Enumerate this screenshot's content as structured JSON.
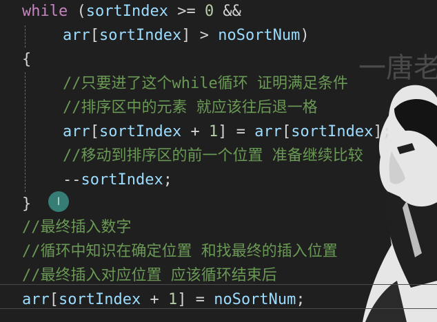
{
  "code": {
    "line1": {
      "kw": "while",
      "paren": " (",
      "var": "sortIndex",
      "op": " >= ",
      "num": "0",
      "and": " &&"
    },
    "line2": {
      "var1": "arr",
      "br1": "[",
      "var2": "sortIndex",
      "br2": "]",
      "op": " > ",
      "var3": "noSortNum",
      "close": ")"
    },
    "line3": {
      "text": "{"
    },
    "line4": {
      "text": "//只要进了这个while循环 证明满足条件"
    },
    "line5": {
      "text": "//排序区中的元素 就应该往后退一格"
    },
    "line6": {
      "var1": "arr",
      "br1": "[",
      "var2": "sortIndex",
      "op1": " + ",
      "num": "1",
      "br2": "] = ",
      "var3": "arr",
      "br3": "[",
      "var4": "sortIndex",
      "br4": "];"
    },
    "line7": {
      "text": "//移动到排序区的前一个位置 准备继续比较"
    },
    "line8": {
      "op": "--",
      "var": "sortIndex",
      "semi": ";"
    },
    "line9": {
      "text": "}"
    },
    "line10": {
      "text": "//最终插入数字"
    },
    "line11": {
      "text": "//循环中知识在确定位置 和找最终的插入位置"
    },
    "line12": {
      "text": "//最终插入对应位置 应该循环结束后"
    },
    "line13": {
      "var1": "arr",
      "br1": "[",
      "var2": "sortIndex",
      "op1": " + ",
      "num": "1",
      "br2": "] = ",
      "var3": "noSortNum",
      "semi": ";"
    }
  },
  "overlay": {
    "watermark": "一唐老",
    "cursor_glyph": "I"
  },
  "colors": {
    "background": "#1f1f1f",
    "keyword": "#c586c0",
    "variable": "#9cdcfe",
    "number": "#b5cea8",
    "comment": "#6a9955",
    "operator": "#d4d4d4"
  }
}
